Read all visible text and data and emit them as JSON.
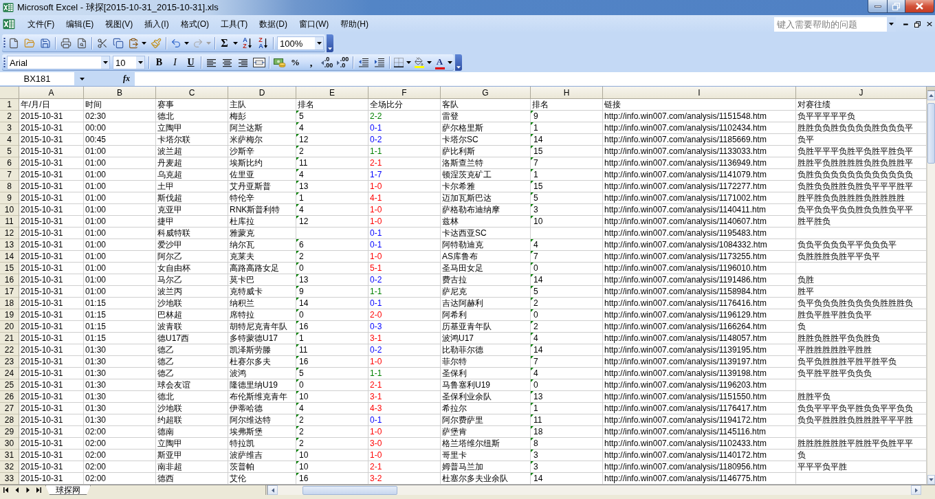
{
  "window": {
    "title": "Microsoft Excel - 球探[2015-10-31_2015-10-31].xls"
  },
  "menu_bar": {
    "items": [
      "文件(F)",
      "编辑(E)",
      "视图(V)",
      "插入(I)",
      "格式(O)",
      "工具(T)",
      "数据(D)",
      "窗口(W)",
      "帮助(H)"
    ],
    "help_search": {
      "placeholder": "键入需要帮助的问题"
    }
  },
  "standard_toolbar": {
    "undo": {
      "disabled": false
    },
    "redo": {
      "disabled": true
    },
    "autosum": "Σ",
    "sort_ascending": [
      "A",
      "Z"
    ],
    "sort_descending": [
      "Z",
      "A"
    ],
    "zoom": "100%"
  },
  "formatting_toolbar": {
    "font": "Arial",
    "font_size": "10",
    "bold": "B",
    "italic": "I",
    "underline": "U",
    "percent": "%",
    "comma": ",",
    "increase_decimal": [
      ".0",
      ".00"
    ],
    "decrease_decimal": [
      ".00",
      ".0"
    ],
    "font_color": "A"
  },
  "formula_bar": {
    "name_box": "BX181",
    "function_label": "fx"
  },
  "sheet": {
    "column_headers": [
      "A",
      "B",
      "C",
      "D",
      "E",
      "F",
      "G",
      "H",
      "I",
      "J"
    ],
    "rows": [
      {
        "number": "1",
        "cells": [
          {
            "text": "年/月/日"
          },
          {
            "text": "时间"
          },
          {
            "text": "赛事"
          },
          {
            "text": "主队"
          },
          {
            "text": "排名",
            "flag": false
          },
          {
            "text": "全场比分"
          },
          {
            "text": "客队"
          },
          {
            "text": "排名",
            "flag": false
          },
          {
            "text": "链接"
          },
          {
            "text": "对赛往绩"
          }
        ]
      },
      {
        "number": "2",
        "cells": [
          {
            "text": "2015-10-31"
          },
          {
            "text": "02:30"
          },
          {
            "text": "德北"
          },
          {
            "text": "梅彭"
          },
          {
            "text": "5",
            "flag": true
          },
          {
            "text": "2-2",
            "color": "#008000"
          },
          {
            "text": "雷登"
          },
          {
            "text": "9",
            "flag": true
          },
          {
            "text": "http://info.win007.com/analysis/1151548.htm"
          },
          {
            "text": "负平平平平平负"
          }
        ]
      },
      {
        "number": "3",
        "cells": [
          {
            "text": "2015-10-31"
          },
          {
            "text": "00:00"
          },
          {
            "text": "立陶甲"
          },
          {
            "text": "阿兰达斯"
          },
          {
            "text": "4",
            "flag": true
          },
          {
            "text": "0-1",
            "color": "#0000ff"
          },
          {
            "text": "萨尔格里斯"
          },
          {
            "text": "1",
            "flag": true
          },
          {
            "text": "http://info.win007.com/analysis/1102434.htm"
          },
          {
            "text": "胜胜负负胜负负负负胜负负负平"
          }
        ]
      },
      {
        "number": "4",
        "cells": [
          {
            "text": "2015-10-31"
          },
          {
            "text": "00:45"
          },
          {
            "text": "卡塔尔联"
          },
          {
            "text": "米萨梅尔"
          },
          {
            "text": "12",
            "flag": true
          },
          {
            "text": "0-2",
            "color": "#0000ff"
          },
          {
            "text": "卡塔尔SC"
          },
          {
            "text": "14",
            "flag": true
          },
          {
            "text": "http://info.win007.com/analysis/1185669.htm"
          },
          {
            "text": "负平"
          }
        ]
      },
      {
        "number": "5",
        "cells": [
          {
            "text": "2015-10-31"
          },
          {
            "text": "01:00"
          },
          {
            "text": "波兰超"
          },
          {
            "text": "沙斯辛"
          },
          {
            "text": "2",
            "flag": true
          },
          {
            "text": "1-1",
            "color": "#008000"
          },
          {
            "text": "萨比利斯"
          },
          {
            "text": "15",
            "flag": true
          },
          {
            "text": "http://info.win007.com/analysis/1133033.htm"
          },
          {
            "text": "负胜平平平负胜平负胜平胜负平"
          }
        ]
      },
      {
        "number": "6",
        "cells": [
          {
            "text": "2015-10-31"
          },
          {
            "text": "01:00"
          },
          {
            "text": "丹麦超"
          },
          {
            "text": "埃斯比约"
          },
          {
            "text": "11",
            "flag": true
          },
          {
            "text": "2-1",
            "color": "#ff0000"
          },
          {
            "text": "洛斯查兰特"
          },
          {
            "text": "7",
            "flag": true
          },
          {
            "text": "http://info.win007.com/analysis/1136949.htm"
          },
          {
            "text": "胜胜平负胜胜胜胜负胜负胜胜平"
          }
        ]
      },
      {
        "number": "7",
        "cells": [
          {
            "text": "2015-10-31"
          },
          {
            "text": "01:00"
          },
          {
            "text": "乌克超"
          },
          {
            "text": "佐里亚"
          },
          {
            "text": "4",
            "flag": true
          },
          {
            "text": "1-7",
            "color": "#0000ff"
          },
          {
            "text": "顿涅茨克矿工"
          },
          {
            "text": "1",
            "flag": true
          },
          {
            "text": "http://info.win007.com/analysis/1141079.htm"
          },
          {
            "text": "负胜负负负负负负负负负负负负"
          }
        ]
      },
      {
        "number": "8",
        "cells": [
          {
            "text": "2015-10-31"
          },
          {
            "text": "01:00"
          },
          {
            "text": "土甲"
          },
          {
            "text": "艾丹亚斯普"
          },
          {
            "text": "13",
            "flag": true
          },
          {
            "text": "1-0",
            "color": "#ff0000"
          },
          {
            "text": "卡尔希雅"
          },
          {
            "text": "15",
            "flag": true
          },
          {
            "text": "http://info.win007.com/analysis/1172277.htm"
          },
          {
            "text": "负胜负负胜胜负胜负平平平胜平"
          }
        ]
      },
      {
        "number": "9",
        "cells": [
          {
            "text": "2015-10-31"
          },
          {
            "text": "01:00"
          },
          {
            "text": "斯伐超"
          },
          {
            "text": "特伦辛"
          },
          {
            "text": "1",
            "flag": true
          },
          {
            "text": "4-1",
            "color": "#ff0000"
          },
          {
            "text": "迈加瓦斯巴达"
          },
          {
            "text": "5",
            "flag": true
          },
          {
            "text": "http://info.win007.com/analysis/1171002.htm"
          },
          {
            "text": "胜平胜负负胜胜胜负胜胜胜胜"
          }
        ]
      },
      {
        "number": "10",
        "cells": [
          {
            "text": "2015-10-31"
          },
          {
            "text": "01:00"
          },
          {
            "text": "克亚甲"
          },
          {
            "text": "RNK斯普利特"
          },
          {
            "text": "4",
            "flag": true
          },
          {
            "text": "1-0",
            "color": "#ff0000"
          },
          {
            "text": "萨格勒布迪纳摩"
          },
          {
            "text": "3",
            "flag": true
          },
          {
            "text": "http://info.win007.com/analysis/1140411.htm"
          },
          {
            "text": "负平负负平负负胜负负胜负平平"
          }
        ]
      },
      {
        "number": "11",
        "cells": [
          {
            "text": "2015-10-31"
          },
          {
            "text": "01:00"
          },
          {
            "text": "捷甲"
          },
          {
            "text": "杜库拉"
          },
          {
            "text": "12",
            "flag": true
          },
          {
            "text": "1-0",
            "color": "#ff0000"
          },
          {
            "text": "兹林"
          },
          {
            "text": "10",
            "flag": true
          },
          {
            "text": "http://info.win007.com/analysis/1140607.htm"
          },
          {
            "text": "胜平胜负"
          }
        ]
      },
      {
        "number": "12",
        "cells": [
          {
            "text": "2015-10-31"
          },
          {
            "text": "01:00"
          },
          {
            "text": "科威特联"
          },
          {
            "text": "雅蒙克"
          },
          null,
          {
            "text": "0-1",
            "color": "#0000ff"
          },
          {
            "text": "卡达西亚SC"
          },
          null,
          {
            "text": "http://info.win007.com/analysis/1195483.htm"
          }
        ]
      },
      {
        "number": "13",
        "cells": [
          {
            "text": "2015-10-31"
          },
          {
            "text": "01:00"
          },
          {
            "text": "爱沙甲"
          },
          {
            "text": "纳尔瓦"
          },
          {
            "text": "6",
            "flag": true
          },
          {
            "text": "0-1",
            "color": "#0000ff"
          },
          {
            "text": "阿特勒迪克"
          },
          {
            "text": "4",
            "flag": true
          },
          {
            "text": "http://info.win007.com/analysis/1084332.htm"
          },
          {
            "text": "负负平负负负平平负负负平"
          }
        ]
      },
      {
        "number": "14",
        "cells": [
          {
            "text": "2015-10-31"
          },
          {
            "text": "01:00"
          },
          {
            "text": "阿尔乙"
          },
          {
            "text": "克莱夫"
          },
          {
            "text": "2",
            "flag": true
          },
          {
            "text": "1-0",
            "color": "#ff0000"
          },
          {
            "text": "AS库鲁布"
          },
          {
            "text": "7",
            "flag": true
          },
          {
            "text": "http://info.win007.com/analysis/1173255.htm"
          },
          {
            "text": "负胜胜胜负胜平平负平"
          }
        ]
      },
      {
        "number": "15",
        "cells": [
          {
            "text": "2015-10-31"
          },
          {
            "text": "01:00"
          },
          {
            "text": "女自由杯"
          },
          {
            "text": "高路高路女足"
          },
          {
            "text": "0",
            "flag": true
          },
          {
            "text": "5-1",
            "color": "#ff0000"
          },
          {
            "text": "圣马田女足"
          },
          {
            "text": "0",
            "flag": true
          },
          {
            "text": "http://info.win007.com/analysis/1196010.htm"
          }
        ]
      },
      {
        "number": "16",
        "cells": [
          {
            "text": "2015-10-31"
          },
          {
            "text": "01:00"
          },
          {
            "text": "马尔乙"
          },
          {
            "text": "莫卡巴"
          },
          {
            "text": "13",
            "flag": true
          },
          {
            "text": "0-2",
            "color": "#0000ff"
          },
          {
            "text": "费古拉"
          },
          {
            "text": "14",
            "flag": true
          },
          {
            "text": "http://info.win007.com/analysis/1191486.htm"
          },
          {
            "text": "负胜"
          }
        ]
      },
      {
        "number": "17",
        "cells": [
          {
            "text": "2015-10-31"
          },
          {
            "text": "01:00"
          },
          {
            "text": "波兰丙"
          },
          {
            "text": "克特威卡"
          },
          {
            "text": "9",
            "flag": true
          },
          {
            "text": "1-1",
            "color": "#008000"
          },
          {
            "text": "萨尼克"
          },
          {
            "text": "5",
            "flag": true
          },
          {
            "text": "http://info.win007.com/analysis/1158984.htm"
          },
          {
            "text": "胜平"
          }
        ]
      },
      {
        "number": "18",
        "cells": [
          {
            "text": "2015-10-31"
          },
          {
            "text": "01:15"
          },
          {
            "text": "沙地联"
          },
          {
            "text": "纳积兰"
          },
          {
            "text": "14",
            "flag": true
          },
          {
            "text": "0-1",
            "color": "#0000ff"
          },
          {
            "text": "吉达阿赫利"
          },
          {
            "text": "2",
            "flag": true
          },
          {
            "text": "http://info.win007.com/analysis/1176416.htm"
          },
          {
            "text": "负平负负负胜负负负负胜胜胜负"
          }
        ]
      },
      {
        "number": "19",
        "cells": [
          {
            "text": "2015-10-31"
          },
          {
            "text": "01:15"
          },
          {
            "text": "巴林超"
          },
          {
            "text": "席特拉"
          },
          {
            "text": "0",
            "flag": true
          },
          {
            "text": "2-0",
            "color": "#ff0000"
          },
          {
            "text": "阿希利"
          },
          {
            "text": "0",
            "flag": true
          },
          {
            "text": "http://info.win007.com/analysis/1196129.htm"
          },
          {
            "text": "胜负平胜平胜负负平"
          }
        ]
      },
      {
        "number": "20",
        "cells": [
          {
            "text": "2015-10-31"
          },
          {
            "text": "01:15"
          },
          {
            "text": "波青联"
          },
          {
            "text": "胡特尼克青年队"
          },
          {
            "text": "16",
            "flag": true
          },
          {
            "text": "0-3",
            "color": "#0000ff"
          },
          {
            "text": "历基亚青年队"
          },
          {
            "text": "2",
            "flag": true
          },
          {
            "text": "http://info.win007.com/analysis/1166264.htm"
          },
          {
            "text": "负"
          }
        ]
      },
      {
        "number": "21",
        "cells": [
          {
            "text": "2015-10-31"
          },
          {
            "text": "01:15"
          },
          {
            "text": "德U17西"
          },
          {
            "text": "多特蒙德U17"
          },
          {
            "text": "1",
            "flag": true
          },
          {
            "text": "3-1",
            "color": "#ff0000"
          },
          {
            "text": "波鸿U17"
          },
          {
            "text": "4",
            "flag": true
          },
          {
            "text": "http://info.win007.com/analysis/1148057.htm"
          },
          {
            "text": "胜胜负胜胜平负负胜负"
          }
        ]
      },
      {
        "number": "22",
        "cells": [
          {
            "text": "2015-10-31"
          },
          {
            "text": "01:30"
          },
          {
            "text": "德乙"
          },
          {
            "text": "凯泽斯劳滕"
          },
          {
            "text": "11",
            "flag": true
          },
          {
            "text": "0-2",
            "color": "#0000ff"
          },
          {
            "text": "比勒菲尔德"
          },
          {
            "text": "14",
            "flag": true
          },
          {
            "text": "http://info.win007.com/analysis/1139195.htm"
          },
          {
            "text": "平胜胜胜胜胜平胜胜"
          }
        ]
      },
      {
        "number": "23",
        "cells": [
          {
            "text": "2015-10-31"
          },
          {
            "text": "01:30"
          },
          {
            "text": "德乙"
          },
          {
            "text": "杜赛尔多夫"
          },
          {
            "text": "16",
            "flag": true
          },
          {
            "text": "1-0",
            "color": "#ff0000"
          },
          {
            "text": "菲尔特"
          },
          {
            "text": "7",
            "flag": true
          },
          {
            "text": "http://info.win007.com/analysis/1139197.htm"
          },
          {
            "text": "负平负胜胜胜平胜平胜平负"
          }
        ]
      },
      {
        "number": "24",
        "cells": [
          {
            "text": "2015-10-31"
          },
          {
            "text": "01:30"
          },
          {
            "text": "德乙"
          },
          {
            "text": "波鸿"
          },
          {
            "text": "5",
            "flag": true
          },
          {
            "text": "1-1",
            "color": "#008000"
          },
          {
            "text": "圣保利"
          },
          {
            "text": "4",
            "flag": true
          },
          {
            "text": "http://info.win007.com/analysis/1139198.htm"
          },
          {
            "text": "负平胜平胜平负负负"
          }
        ]
      },
      {
        "number": "25",
        "cells": [
          {
            "text": "2015-10-31"
          },
          {
            "text": "01:30"
          },
          {
            "text": "球会友谊"
          },
          {
            "text": "隆德里纳U19"
          },
          {
            "text": "0",
            "flag": true
          },
          {
            "text": "2-1",
            "color": "#ff0000"
          },
          {
            "text": "马鲁塞利U19"
          },
          {
            "text": "0",
            "flag": true
          },
          {
            "text": "http://info.win007.com/analysis/1196203.htm"
          }
        ]
      },
      {
        "number": "26",
        "cells": [
          {
            "text": "2015-10-31"
          },
          {
            "text": "01:30"
          },
          {
            "text": "德北"
          },
          {
            "text": "布伦斯维克青年"
          },
          {
            "text": "10",
            "flag": true
          },
          {
            "text": "3-1",
            "color": "#ff0000"
          },
          {
            "text": "圣保利业余队"
          },
          {
            "text": "13",
            "flag": true
          },
          {
            "text": "http://info.win007.com/analysis/1151550.htm"
          },
          {
            "text": "胜胜平负"
          }
        ]
      },
      {
        "number": "27",
        "cells": [
          {
            "text": "2015-10-31"
          },
          {
            "text": "01:30"
          },
          {
            "text": "沙地联"
          },
          {
            "text": "伊蒂哈德"
          },
          {
            "text": "4",
            "flag": true
          },
          {
            "text": "4-3",
            "color": "#ff0000"
          },
          {
            "text": "希拉尔"
          },
          {
            "text": "1",
            "flag": true
          },
          {
            "text": "http://info.win007.com/analysis/1176417.htm"
          },
          {
            "text": "负负平平平负平胜负负平平负负"
          }
        ]
      },
      {
        "number": "28",
        "cells": [
          {
            "text": "2015-10-31"
          },
          {
            "text": "01:30"
          },
          {
            "text": "约超联"
          },
          {
            "text": "阿尔维达特"
          },
          {
            "text": "2",
            "flag": true
          },
          {
            "text": "0-1",
            "color": "#0000ff"
          },
          {
            "text": "阿尔费萨里"
          },
          {
            "text": "11",
            "flag": true
          },
          {
            "text": "http://info.win007.com/analysis/1194172.htm"
          },
          {
            "text": "负负平胜胜胜负胜胜胜平平平胜"
          }
        ]
      },
      {
        "number": "29",
        "cells": [
          {
            "text": "2015-10-31"
          },
          {
            "text": "02:00"
          },
          {
            "text": "德南"
          },
          {
            "text": "埃弗斯堡"
          },
          {
            "text": "2",
            "flag": true
          },
          {
            "text": "1-0",
            "color": "#ff0000"
          },
          {
            "text": "萨堡肯"
          },
          {
            "text": "18",
            "flag": true
          },
          {
            "text": "http://info.win007.com/analysis/1145116.htm"
          }
        ]
      },
      {
        "number": "30",
        "cells": [
          {
            "text": "2015-10-31"
          },
          {
            "text": "02:00"
          },
          {
            "text": "立陶甲"
          },
          {
            "text": "特拉凯"
          },
          {
            "text": "2",
            "flag": true
          },
          {
            "text": "3-0",
            "color": "#ff0000"
          },
          {
            "text": "格兰塔维尔纽斯"
          },
          {
            "text": "8",
            "flag": true
          },
          {
            "text": "http://info.win007.com/analysis/1102433.htm"
          },
          {
            "text": "胜胜胜胜胜胜平胜胜平负胜平平"
          }
        ]
      },
      {
        "number": "31",
        "cells": [
          {
            "text": "2015-10-31"
          },
          {
            "text": "02:00"
          },
          {
            "text": "斯亚甲"
          },
          {
            "text": "波萨维吉"
          },
          {
            "text": "10",
            "flag": true
          },
          {
            "text": "1-0",
            "color": "#ff0000"
          },
          {
            "text": "哥里卡"
          },
          {
            "text": "3",
            "flag": true
          },
          {
            "text": "http://info.win007.com/analysis/1140172.htm"
          },
          {
            "text": "负"
          }
        ]
      },
      {
        "number": "32",
        "cells": [
          {
            "text": "2015-10-31"
          },
          {
            "text": "02:00"
          },
          {
            "text": "南非超"
          },
          {
            "text": "茨普帕"
          },
          {
            "text": "10",
            "flag": true
          },
          {
            "text": "2-1",
            "color": "#ff0000"
          },
          {
            "text": "姆普马兰加"
          },
          {
            "text": "3",
            "flag": true
          },
          {
            "text": "http://info.win007.com/analysis/1180956.htm"
          },
          {
            "text": "平平平负平胜"
          }
        ]
      },
      {
        "number": "33",
        "cells": [
          {
            "text": "2015-10-31"
          },
          {
            "text": "02:00"
          },
          {
            "text": "德西"
          },
          {
            "text": "艾伦"
          },
          {
            "text": "16",
            "flag": true
          },
          {
            "text": "3-2",
            "color": "#ff0000"
          },
          {
            "text": "杜塞尔多夫业余队"
          },
          {
            "text": "14",
            "flag": true
          },
          {
            "text": "http://info.win007.com/analysis/1146775.htm"
          }
        ]
      }
    ]
  },
  "sheet_tabs": [
    {
      "label": "球探网",
      "selected": true
    }
  ]
}
